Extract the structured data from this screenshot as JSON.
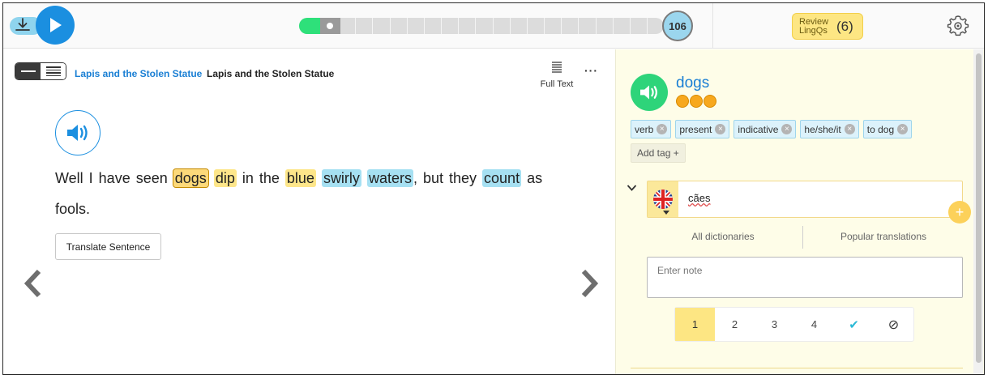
{
  "player": {
    "page_number": "106",
    "progress_fraction": 0.06
  },
  "review": {
    "label": "Review LingQs",
    "count": "(6)"
  },
  "reader": {
    "breadcrumb_link": "Lapis and the Stolen Statue",
    "breadcrumb_title": "Lapis and the Stolen Statue",
    "full_text_label": "Full Text",
    "more_label": "···",
    "translate_label": "Translate Sentence",
    "sentence": [
      {
        "t": "Well I have seen ",
        "s": "plain"
      },
      {
        "t": "dogs",
        "s": "selected"
      },
      {
        "t": " ",
        "s": "plain"
      },
      {
        "t": "dip",
        "s": "yellow"
      },
      {
        "t": " in the ",
        "s": "plain"
      },
      {
        "t": "blue",
        "s": "yellow"
      },
      {
        "t": " ",
        "s": "plain"
      },
      {
        "t": "swirly",
        "s": "blue"
      },
      {
        "t": " ",
        "s": "plain"
      },
      {
        "t": "waters",
        "s": "blue"
      },
      {
        "t": ", but they ",
        "s": "plain"
      },
      {
        "t": "count",
        "s": "blue"
      },
      {
        "t": " as fools.",
        "s": "plain"
      }
    ]
  },
  "panel": {
    "term": "dogs",
    "tags": [
      "verb",
      "present",
      "indicative",
      "he/she/it",
      "to dog"
    ],
    "add_tag_label": "Add tag +",
    "hint_value": "cães",
    "add_hint_symbol": "+",
    "dict_tabs": [
      "All dictionaries",
      "Popular translations"
    ],
    "note_placeholder": "Enter note",
    "statuses": [
      "1",
      "2",
      "3",
      "4",
      "✔",
      "⊘"
    ],
    "active_status": "1"
  },
  "colors": {
    "accent_blue": "#1b8fe0",
    "audio_green": "#2ed47a",
    "highlight_yellow": "#fde68a",
    "highlight_blue": "#a6e0f2",
    "panel_bg": "#fefde8",
    "known_check": "#2bb9d6"
  },
  "icons": [
    "download-icon",
    "play-icon",
    "settings-gear-icon",
    "view-toggle-icon",
    "full-text-icon",
    "speaker-icon",
    "chevron-left-icon",
    "chevron-right-icon",
    "chevron-down-icon",
    "uk-flag-icon",
    "tag-remove-icon",
    "check-icon",
    "ignore-icon"
  ]
}
